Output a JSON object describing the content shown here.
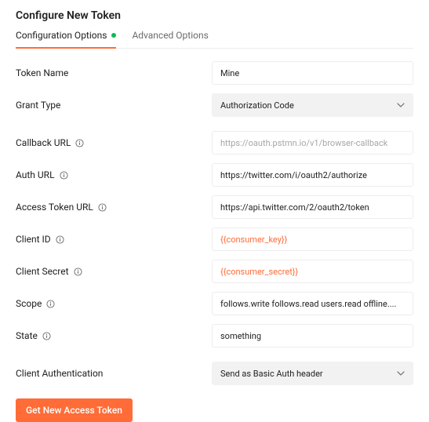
{
  "title": "Configure New Token",
  "tabs": {
    "config": "Configuration Options",
    "advanced": "Advanced Options"
  },
  "labels": {
    "token_name": "Token Name",
    "grant_type": "Grant Type",
    "callback_url": "Callback URL",
    "auth_url": "Auth URL",
    "access_token_url": "Access Token URL",
    "client_id": "Client ID",
    "client_secret": "Client Secret",
    "scope": "Scope",
    "state": "State",
    "client_auth": "Client Authentication"
  },
  "values": {
    "token_name": "Mine",
    "grant_type": "Authorization Code",
    "callback_url": "https://oauth.pstmn.io/v1/browser-callback",
    "auth_url": "https://twitter.com/i/oauth2/authorize",
    "access_token_url": "https://api.twitter.com/2/oauth2/token",
    "client_id": "{{consumer_key}}",
    "client_secret": "{{consumer_secret}}",
    "scope": "follows.write follows.read users.read offline....",
    "state": "something",
    "client_auth": "Send as Basic Auth header"
  },
  "button": "Get New Access Token"
}
